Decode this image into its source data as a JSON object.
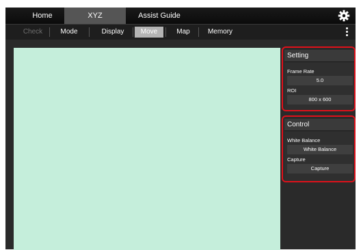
{
  "topbar": {
    "tabs": [
      {
        "label": "Home"
      },
      {
        "label": "XYZ"
      },
      {
        "label": "Assist Guide"
      }
    ],
    "settings_icon": "gear-icon"
  },
  "subbar": {
    "tabs": [
      {
        "label": "Check",
        "state": "disabled"
      },
      {
        "label": "Mode"
      },
      {
        "label": "Display"
      },
      {
        "label": "Move",
        "state": "active"
      },
      {
        "label": "Map"
      },
      {
        "label": "Memory"
      }
    ],
    "more_icon": "kebab-menu-icon"
  },
  "viewport": {
    "color": "#c5eedb"
  },
  "setting_panel": {
    "title": "Setting",
    "frame_rate_label": "Frame Rate",
    "frame_rate_value": "5.0",
    "roi_label": "ROI",
    "roi_value": "800 x 600"
  },
  "control_panel": {
    "title": "Control",
    "white_balance_label": "White Balance",
    "white_balance_button": "White Balance",
    "capture_label": "Capture",
    "capture_button": "Capture"
  },
  "highlight_color": "#e0101a"
}
